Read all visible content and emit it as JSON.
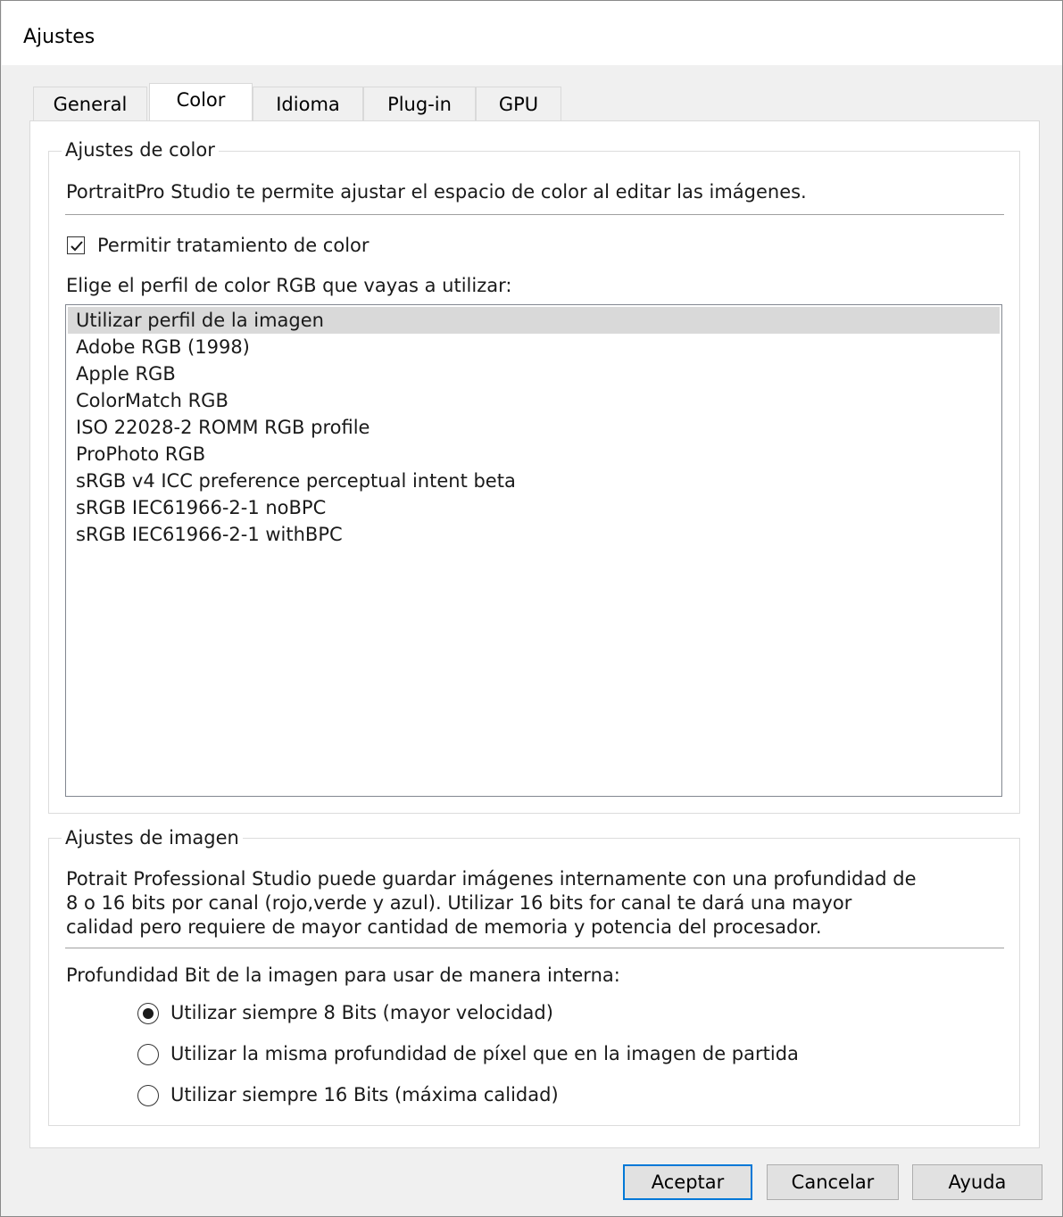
{
  "window": {
    "title": "Ajustes"
  },
  "tabs": [
    {
      "label": "General",
      "active": false
    },
    {
      "label": "Color",
      "active": true
    },
    {
      "label": "Idioma",
      "active": false
    },
    {
      "label": "Plug-in",
      "active": false
    },
    {
      "label": "GPU",
      "active": false
    }
  ],
  "color_settings": {
    "legend": "Ajustes de color",
    "description": "PortraitPro Studio te permite ajustar el espacio de color al editar las imágenes.",
    "enable_color_management": {
      "label": "Permitir tratamiento de color",
      "checked": true
    },
    "profile_prompt": "Elige el perfil de color RGB que vayas a utilizar:",
    "profiles": [
      "Utilizar perfil de la imagen",
      "Adobe RGB (1998)",
      "Apple RGB",
      "ColorMatch RGB",
      "ISO 22028-2 ROMM RGB profile",
      "ProPhoto RGB",
      "sRGB v4 ICC preference perceptual intent beta",
      "sRGB IEC61966-2-1 noBPC",
      "sRGB IEC61966-2-1 withBPC"
    ],
    "selected_profile": "Utilizar perfil de la imagen"
  },
  "image_settings": {
    "legend": "Ajustes de imagen",
    "description_lines": [
      "Potrait Professional Studio puede guardar imágenes internamente con una profundidad de",
      "8 o 16 bits por canal (rojo,verde y azul). Utilizar 16 bits for canal te dará una mayor",
      "calidad pero requiere de mayor cantidad de memoria y potencia del procesador."
    ],
    "bit_depth_prompt": "Profundidad Bit de la imagen para usar de manera interna:",
    "bit_depth_options": [
      "Utilizar siempre 8 Bits (mayor velocidad)",
      "Utilizar la misma profundidad de píxel que en la imagen de partida",
      "Utilizar siempre 16 Bits (máxima calidad)"
    ],
    "selected_bit_depth": "Utilizar siempre 8 Bits (mayor velocidad)"
  },
  "buttons": {
    "ok": "Aceptar",
    "cancel": "Cancelar",
    "help": "Ayuda"
  },
  "colors": {
    "dialog_bg": "#f0f0f0",
    "panel_bg": "#ffffff",
    "selection_bg": "#d9d9d9",
    "default_button_border": "#0078d7"
  }
}
